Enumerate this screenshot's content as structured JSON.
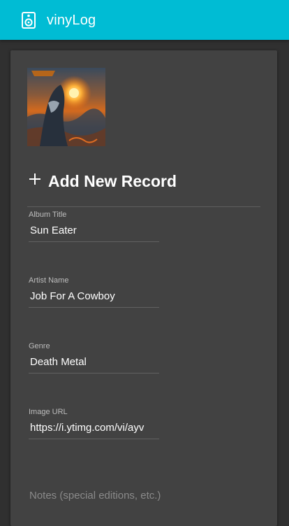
{
  "app": {
    "title": "vinyLog",
    "logo_icon": "speaker-icon",
    "accent_color": "#00bcd4"
  },
  "form": {
    "heading": "Add New Record",
    "heading_icon": "plus-icon",
    "fields": [
      {
        "label": "Album Title",
        "value": "Sun Eater"
      },
      {
        "label": "Artist Name",
        "value": "Job For A Cowboy"
      },
      {
        "label": "Genre",
        "value": "Death Metal"
      },
      {
        "label": "Image URL",
        "value": "https://i.ytimg.com/vi/ayv"
      }
    ],
    "notes_placeholder": "Notes (special editions, etc.)"
  }
}
